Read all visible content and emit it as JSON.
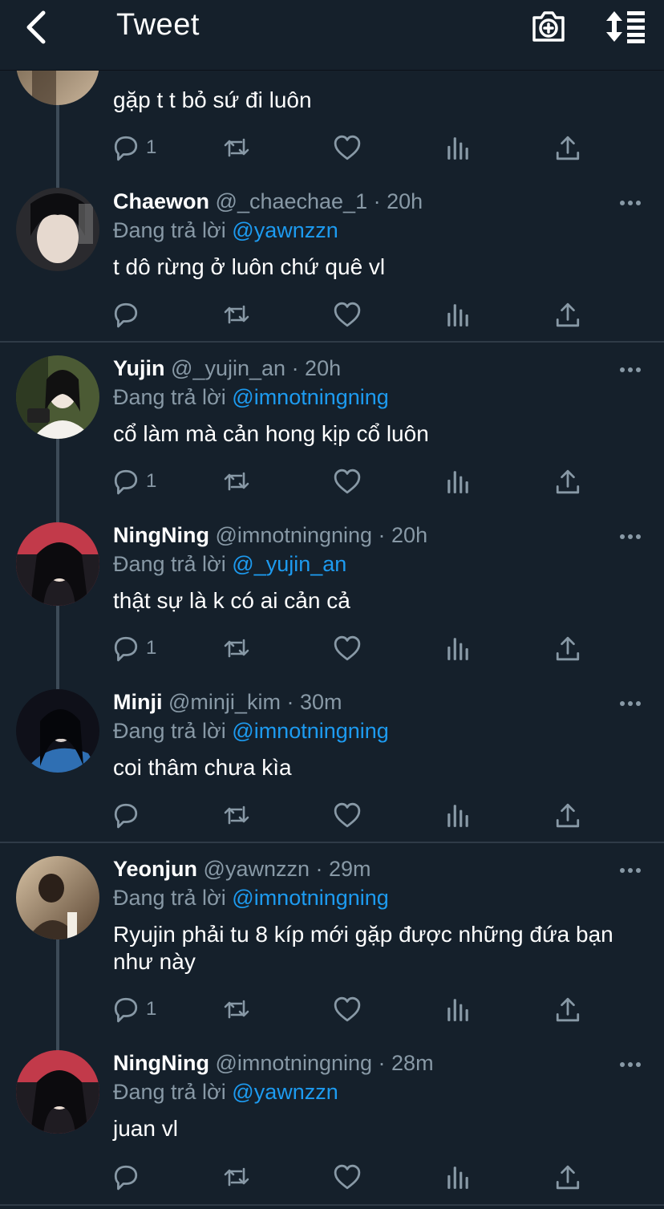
{
  "header": {
    "title": "Tweet",
    "back_icon": "chevron-left-icon",
    "camera_icon": "camera-plus-icon",
    "sort_icon": "sort-icon"
  },
  "colors": {
    "background": "#15202b",
    "secondary_text": "#8899a6",
    "mention": "#1d9bf0",
    "separator": "#2f3b47"
  },
  "reply_prefix": "Đang trả lời",
  "tweets": [
    {
      "text": "gặp t t bỏ sứ đi luôn",
      "reply_count": "1",
      "avatar_colors": [
        "#6b5a45",
        "#c9b49a"
      ]
    },
    {
      "name": "Chaewon",
      "handle": "@_chaechae_1",
      "time": "· 20h",
      "reply_to": "@yawnzzn",
      "text": "t dô rừng ở luôn chứ quê vl",
      "reply_count": "",
      "avatar_colors": [
        "#2a2a2e",
        "#d9cfc7"
      ]
    },
    {
      "name": "Yujin",
      "handle": "@_yujin_an",
      "time": "· 20h",
      "reply_to": "@imnotningning",
      "text": "cổ làm mà cản hong kịp cổ luôn",
      "reply_count": "1",
      "avatar_colors": [
        "#3c4a2e",
        "#e9e4dc"
      ]
    },
    {
      "name": "NingNing",
      "handle": "@imnotningning",
      "time": "· 20h",
      "reply_to": "@_yujin_an",
      "text": "thật sự là k có ai cản cả",
      "reply_count": "1",
      "avatar_colors": [
        "#1e1b20",
        "#c83a4a"
      ]
    },
    {
      "name": "Minji",
      "handle": "@minji_kim",
      "time": "· 30m",
      "reply_to": "@imnotningning",
      "text": "coi thâm chưa kìa",
      "reply_count": "",
      "avatar_colors": [
        "#0e0f18",
        "#2f6fb3"
      ]
    },
    {
      "name": "Yeonjun",
      "handle": "@yawnzzn",
      "time": "· 29m",
      "reply_to": "@imnotningning",
      "text": "Ryujin phải tu 8 kíp mới gặp được những đứa bạn như này",
      "reply_count": "1",
      "avatar_colors": [
        "#5a4532",
        "#d8c3a5"
      ]
    },
    {
      "name": "NingNing",
      "handle": "@imnotningning",
      "time": "· 28m",
      "reply_to": "@yawnzzn",
      "text": "juan vl",
      "reply_count": "",
      "avatar_colors": [
        "#1e1b20",
        "#c83a4a"
      ]
    }
  ]
}
